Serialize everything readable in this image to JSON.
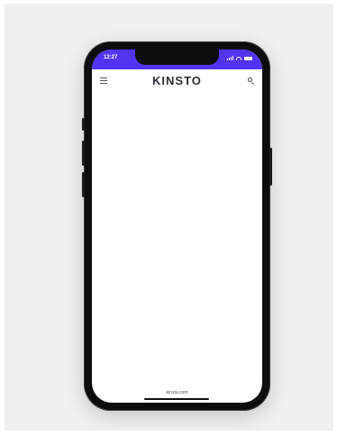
{
  "status_bar": {
    "time": "12:27",
    "color": "#5333ed"
  },
  "header": {
    "logo": "KINSTO",
    "menu_icon": "hamburger-menu-icon",
    "search_icon": "search-icon"
  },
  "footer": {
    "url": "kinsta.com"
  }
}
